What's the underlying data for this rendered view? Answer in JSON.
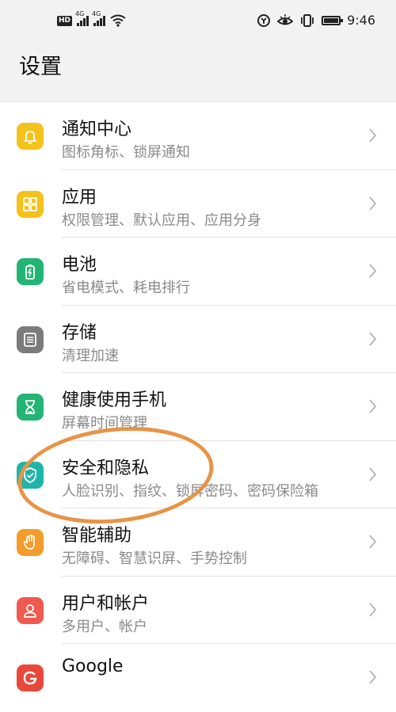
{
  "status_bar": {
    "hd_label": "HD",
    "network_type": "4G",
    "time": "9:46",
    "left_icons": [
      "hd-voice-icon",
      "signal-icon",
      "signal-icon",
      "wifi-icon"
    ],
    "right_icons": [
      "app-notification-icon",
      "eye-icon",
      "vibrate-icon",
      "battery-icon"
    ]
  },
  "page": {
    "title": "设置"
  },
  "settings": {
    "items": [
      {
        "title": "通知中心",
        "subtitle": "图标角标、锁屏通知",
        "icon": "bell-icon",
        "color": "#f4c21b"
      },
      {
        "title": "应用",
        "subtitle": "权限管理、默认应用、应用分身",
        "icon": "apps-icon",
        "color": "#f4c21b"
      },
      {
        "title": "电池",
        "subtitle": "省电模式、耗电排行",
        "icon": "battery-icon",
        "color": "#22b573"
      },
      {
        "title": "存储",
        "subtitle": "清理加速",
        "icon": "storage-icon",
        "color": "#7b7b7b"
      },
      {
        "title": "健康使用手机",
        "subtitle": "屏幕时间管理",
        "icon": "hourglass-icon",
        "color": "#22b573"
      },
      {
        "title": "安全和隐私",
        "subtitle": "人脸识别、指纹、锁屏密码、密码保险箱",
        "icon": "shield-icon",
        "color": "#1fb5a8"
      },
      {
        "title": "智能辅助",
        "subtitle": "无障碍、智慧识屏、手势控制",
        "icon": "hand-icon",
        "color": "#f39c2b"
      },
      {
        "title": "用户和帐户",
        "subtitle": "多用户、帐户",
        "icon": "user-icon",
        "color": "#ee5a4f"
      },
      {
        "title": "Google",
        "subtitle": "",
        "icon": "google-icon",
        "color": "#e9473b"
      }
    ]
  },
  "annotation": {
    "color": "#e79447"
  }
}
